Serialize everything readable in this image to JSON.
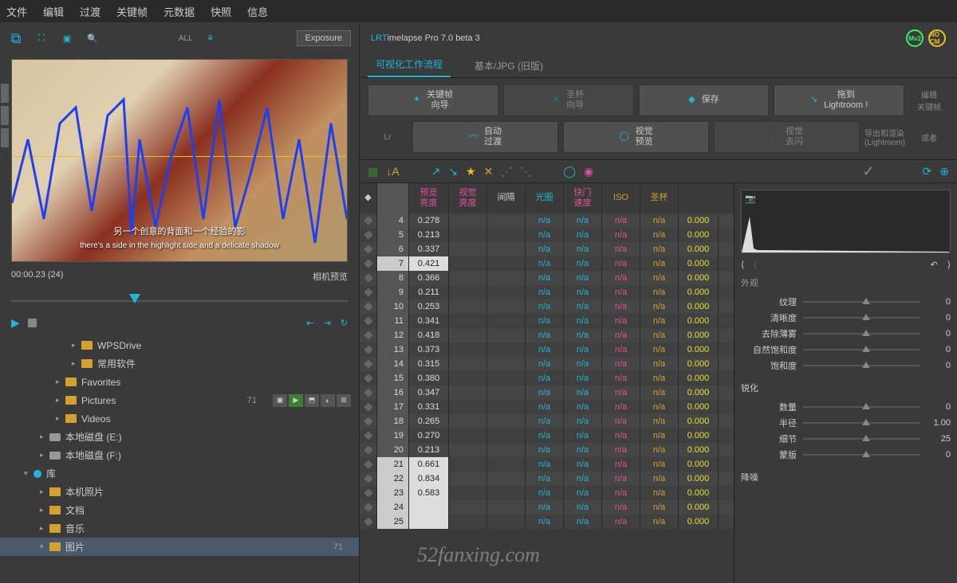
{
  "menu": [
    "文件",
    "编辑",
    "过渡",
    "关键帧",
    "元数据",
    "快照",
    "信息"
  ],
  "toolbar": {
    "all": "ALL",
    "exposure": "Exposure"
  },
  "preview": {
    "sub1": "另一个创意的背面和一个经验的影",
    "sub2": "there's a side in the highlight side and a delicate shadow",
    "timecode": "00:00.23 (24)",
    "cam_preview": "相机预览"
  },
  "tree": [
    {
      "indent": 90,
      "arrow": "▸",
      "icon": "folder",
      "label": "WPSDrive"
    },
    {
      "indent": 90,
      "arrow": "▸",
      "icon": "folder",
      "label": "常用软件"
    },
    {
      "indent": 70,
      "arrow": "▸",
      "icon": "folder",
      "label": "Favorites"
    },
    {
      "indent": 70,
      "arrow": "▸",
      "icon": "folder",
      "label": "Pictures",
      "count": "71",
      "badges": true
    },
    {
      "indent": 70,
      "arrow": "▸",
      "icon": "folder",
      "label": "Videos"
    },
    {
      "indent": 50,
      "arrow": "▸",
      "icon": "disk",
      "label": "本地磁盘 (E:)"
    },
    {
      "indent": 50,
      "arrow": "▸",
      "icon": "disk",
      "label": "本地磁盘 (F:)"
    },
    {
      "indent": 30,
      "arrow": "▾",
      "icon": "lib",
      "label": "库"
    },
    {
      "indent": 50,
      "arrow": "▸",
      "icon": "folder",
      "label": "本机照片"
    },
    {
      "indent": 50,
      "arrow": "▸",
      "icon": "folder",
      "label": "文档"
    },
    {
      "indent": 50,
      "arrow": "▸",
      "icon": "folder",
      "label": "音乐"
    },
    {
      "indent": 50,
      "arrow": "▾",
      "icon": "folder",
      "label": "图片",
      "count": "71",
      "sel": true
    }
  ],
  "appTitle": {
    "pre": "LRT",
    "rest": "imelapse Pro 7.0 beta 3"
  },
  "titleBadges": [
    {
      "t": "Mv2",
      "c": "#3aef6a"
    },
    {
      "t": "NO CM",
      "c": "#e8c020"
    }
  ],
  "tabs": [
    {
      "label": "可视化工作流程",
      "active": true
    },
    {
      "label": "基本/JPG (旧版)"
    }
  ],
  "workflow": {
    "row1": [
      {
        "icon": "✦",
        "label": "关键帧\n向导",
        "cls": ""
      },
      {
        "icon": "✕",
        "label": "圣杯\n向导",
        "cls": "disabled"
      },
      {
        "icon": "◆",
        "label": "保存",
        "cls": ""
      },
      {
        "icon": "↘",
        "label": "拖到\nLightroom !",
        "cls": ""
      }
    ],
    "row1_end": "编辑\n关键帧",
    "lr": "Lr",
    "row2": [
      {
        "icon": "〰",
        "label": "自动\n过渡",
        "cls": ""
      },
      {
        "icon": "◯",
        "label": "视觉\n预览",
        "cls": ""
      },
      {
        "icon": "⋰",
        "label": "视觉\n去闪",
        "cls": "disabled"
      }
    ],
    "row2_end": "导出和渲染\n(Lightroom)",
    "row2_or": "或者"
  },
  "tableHead": [
    {
      "t": "◆",
      "cls": "c0"
    },
    {
      "t": "",
      "cls": "c1"
    },
    {
      "t": "预览\n亮度",
      "cls": "c2",
      "color": "#e050a0"
    },
    {
      "t": "视觉\n亮度",
      "cls": "c3",
      "color": "#e050a0"
    },
    {
      "t": "间隔",
      "cls": "c4"
    },
    {
      "t": "光圈",
      "cls": "c5",
      "color": "#1fb5d8"
    },
    {
      "t": "快门\n速度",
      "cls": "c6",
      "color": "#e050a0"
    },
    {
      "t": "ISO",
      "cls": "c7",
      "color": "#d4a030"
    },
    {
      "t": "圣杯",
      "cls": "c8",
      "color": "#d4a030"
    }
  ],
  "rows": [
    {
      "n": 4,
      "v": "0.278"
    },
    {
      "n": 5,
      "v": "0.213"
    },
    {
      "n": 6,
      "v": "0.337"
    },
    {
      "n": 7,
      "v": "0.421",
      "hl": true
    },
    {
      "n": 8,
      "v": "0.366"
    },
    {
      "n": 9,
      "v": "0.211"
    },
    {
      "n": 10,
      "v": "0.253"
    },
    {
      "n": 11,
      "v": "0.341"
    },
    {
      "n": 12,
      "v": "0.418"
    },
    {
      "n": 13,
      "v": "0.373"
    },
    {
      "n": 14,
      "v": "0.315"
    },
    {
      "n": 15,
      "v": "0.380"
    },
    {
      "n": 16,
      "v": "0.347"
    },
    {
      "n": 17,
      "v": "0.331"
    },
    {
      "n": 18,
      "v": "0.265"
    },
    {
      "n": 19,
      "v": "0.270"
    },
    {
      "n": 20,
      "v": "0.213"
    },
    {
      "n": 21,
      "v": "0.661",
      "hl": true
    },
    {
      "n": 22,
      "v": "0.834",
      "hl": true
    },
    {
      "n": 23,
      "v": "0.583",
      "hl": true
    },
    {
      "n": 24,
      "v": "",
      "hl": true
    },
    {
      "n": 25,
      "v": "",
      "hl": true
    }
  ],
  "na": "n/a",
  "zero": "0.000",
  "props": {
    "section1": "外观",
    "sliders1": [
      {
        "l": "纹理",
        "v": "0"
      },
      {
        "l": "清晰度",
        "v": "0"
      },
      {
        "l": "去除薄雾",
        "v": "0"
      },
      {
        "l": "自然饱和度",
        "v": "0"
      },
      {
        "l": "饱和度",
        "v": "0"
      }
    ],
    "section2": "锐化",
    "sliders2": [
      {
        "l": "数量",
        "v": "0"
      },
      {
        "l": "半径",
        "v": "1.00"
      },
      {
        "l": "细节",
        "v": "25"
      },
      {
        "l": "蒙版",
        "v": "0"
      }
    ],
    "section3": "降噪"
  },
  "watermark": "52fanxing.com"
}
